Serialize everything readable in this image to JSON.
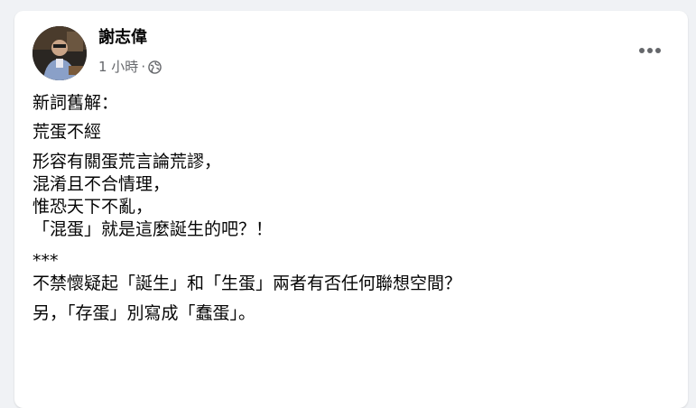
{
  "post": {
    "author": "謝志偉",
    "time": "1 小時",
    "separator": "·",
    "privacy_icon": "globe-icon",
    "more_icon": "more-dots-icon",
    "paragraphs": [
      [
        "新詞舊解："
      ],
      [
        "荒蛋不經"
      ],
      [
        "形容有關蛋荒言論荒謬，",
        "混淆且不合情理，",
        "惟恐天下不亂，",
        "「混蛋」就是這麼誕生的吧？！"
      ],
      [
        "***",
        "不禁懷疑起「誕生」和「生蛋」兩者有否任何聯想空間？"
      ],
      [
        "另，「存蛋」別寫成「蠢蛋」。"
      ]
    ]
  },
  "colors": {
    "background": "#f0f2f5",
    "card": "#ffffff",
    "primary_text": "#050505",
    "secondary_text": "#65676b"
  }
}
